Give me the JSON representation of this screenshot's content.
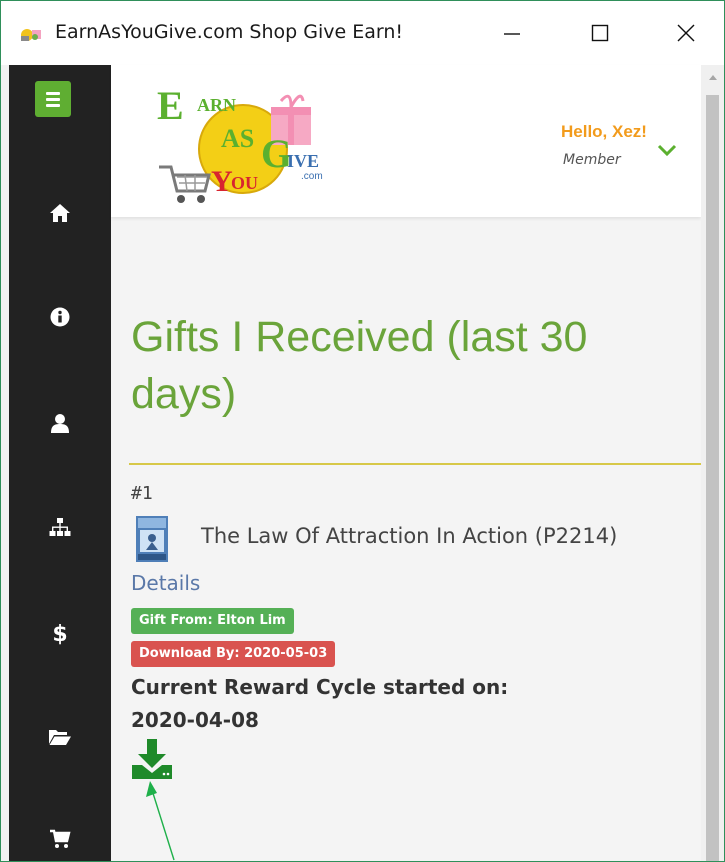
{
  "window": {
    "title": "EarnAsYouGive.com Shop Give Earn!",
    "minimize_label": "Minimize",
    "maximize_label": "Maximize",
    "close_label": "Close"
  },
  "sidebar": {
    "items": [
      {
        "icon": "menu-icon"
      },
      {
        "icon": "home-icon"
      },
      {
        "icon": "info-icon"
      },
      {
        "icon": "user-icon"
      },
      {
        "icon": "sitemap-icon"
      },
      {
        "icon": "dollar-icon"
      },
      {
        "icon": "folder-open-icon"
      },
      {
        "icon": "shopping-cart-icon"
      }
    ],
    "accent_color": "#5fae32"
  },
  "header": {
    "logo_text": "Earn As You Give .com",
    "greeting": "Hello, Xez!",
    "role": "Member"
  },
  "page": {
    "title": "Gifts I Received (last 30 days)"
  },
  "gift": {
    "number": "#1",
    "title": "The Law Of Attraction In Action (P2214)",
    "details_label": "Details",
    "gift_from": "Gift From: Elton Lim",
    "download_by": "Download By: 2020-05-03",
    "cycle_label": "Current Reward Cycle started on:",
    "cycle_date": "2020-04-08",
    "download_icon": "download-icon"
  },
  "colors": {
    "title_green": "#6aa43a",
    "greeting_orange": "#f29b1c",
    "badge_green": "#55b056",
    "badge_red": "#d9534f",
    "link_blue": "#5a78a8",
    "divider_gold": "#d7c848"
  }
}
